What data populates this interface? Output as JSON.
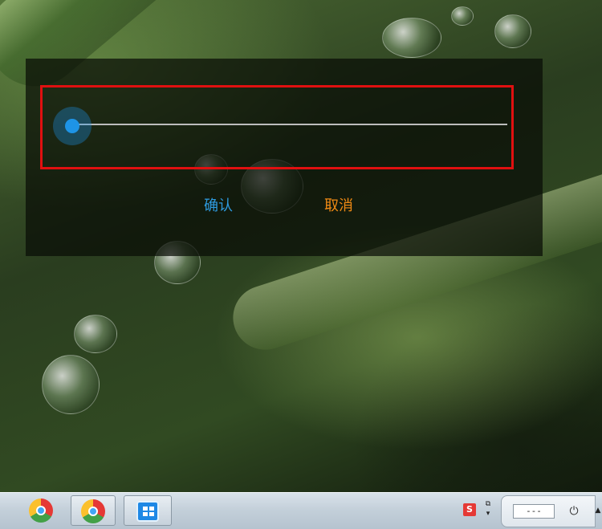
{
  "dialog": {
    "slider": {
      "value_fraction": 0.0,
      "accent_color": "#1e94e6"
    },
    "confirm_label": "确认",
    "cancel_label": "取消",
    "confirm_color": "#2e9be0",
    "cancel_color": "#f08a14",
    "highlight_color": "#e01010"
  },
  "taskbar": {
    "pinned": [
      {
        "icon": "browser-icon"
      },
      {
        "icon": "browser-icon"
      },
      {
        "icon": "app-window-icon"
      }
    ],
    "tray": {
      "ime_label": "S",
      "field_text": "---",
      "plug_icon": "plug-icon"
    }
  }
}
